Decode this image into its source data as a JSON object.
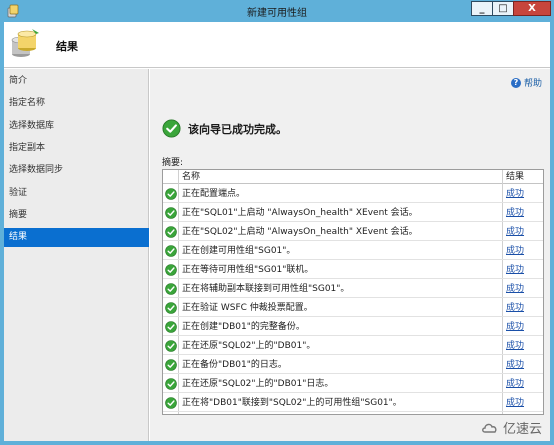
{
  "window": {
    "title": "新建可用性组",
    "minimize": "_",
    "maximize": "□",
    "close": "X"
  },
  "header": {
    "title": "结果"
  },
  "sidebar": {
    "items": [
      {
        "label": "简介"
      },
      {
        "label": "指定名称"
      },
      {
        "label": "选择数据库"
      },
      {
        "label": "指定副本"
      },
      {
        "label": "选择数据同步"
      },
      {
        "label": "验证"
      },
      {
        "label": "摘要"
      },
      {
        "label": "结果",
        "active": true
      }
    ]
  },
  "main": {
    "help_label": "帮助",
    "help_glyph": "?",
    "status_text": "该向导已成功完成。",
    "summary_label": "摘要:",
    "columns": {
      "name": "名称",
      "result": "结果"
    },
    "rows": [
      {
        "name": "正在配置端点。",
        "result": "成功"
      },
      {
        "name": "正在\"SQL01\"上启动 \"AlwaysOn_health\" XEvent 会话。",
        "result": "成功"
      },
      {
        "name": "正在\"SQL02\"上启动 \"AlwaysOn_health\" XEvent 会话。",
        "result": "成功"
      },
      {
        "name": "正在创建可用性组\"SG01\"。",
        "result": "成功"
      },
      {
        "name": "正在等待可用性组\"SG01\"联机。",
        "result": "成功"
      },
      {
        "name": "正在将辅助副本联接到可用性组\"SG01\"。",
        "result": "成功"
      },
      {
        "name": "正在验证 WSFC 仲裁投票配置。",
        "result": "成功"
      },
      {
        "name": "正在创建\"DB01\"的完整备份。",
        "result": "成功"
      },
      {
        "name": "正在还原\"SQL02\"上的\"DB01\"。",
        "result": "成功"
      },
      {
        "name": "正在备份\"DB01\"的日志。",
        "result": "成功"
      },
      {
        "name": "正在还原\"SQL02\"上的\"DB01\"日志。",
        "result": "成功"
      },
      {
        "name": "正在将\"DB01\"联接到\"SQL02\"上的可用性组\"SG01\"。",
        "result": "成功"
      }
    ]
  },
  "watermark": {
    "text": "亿速云"
  },
  "colors": {
    "title_bar": "#5fb0d9",
    "active_nav": "#0a6fd0",
    "success_green": "#3aa53a",
    "link_blue": "#1a4fa8"
  }
}
